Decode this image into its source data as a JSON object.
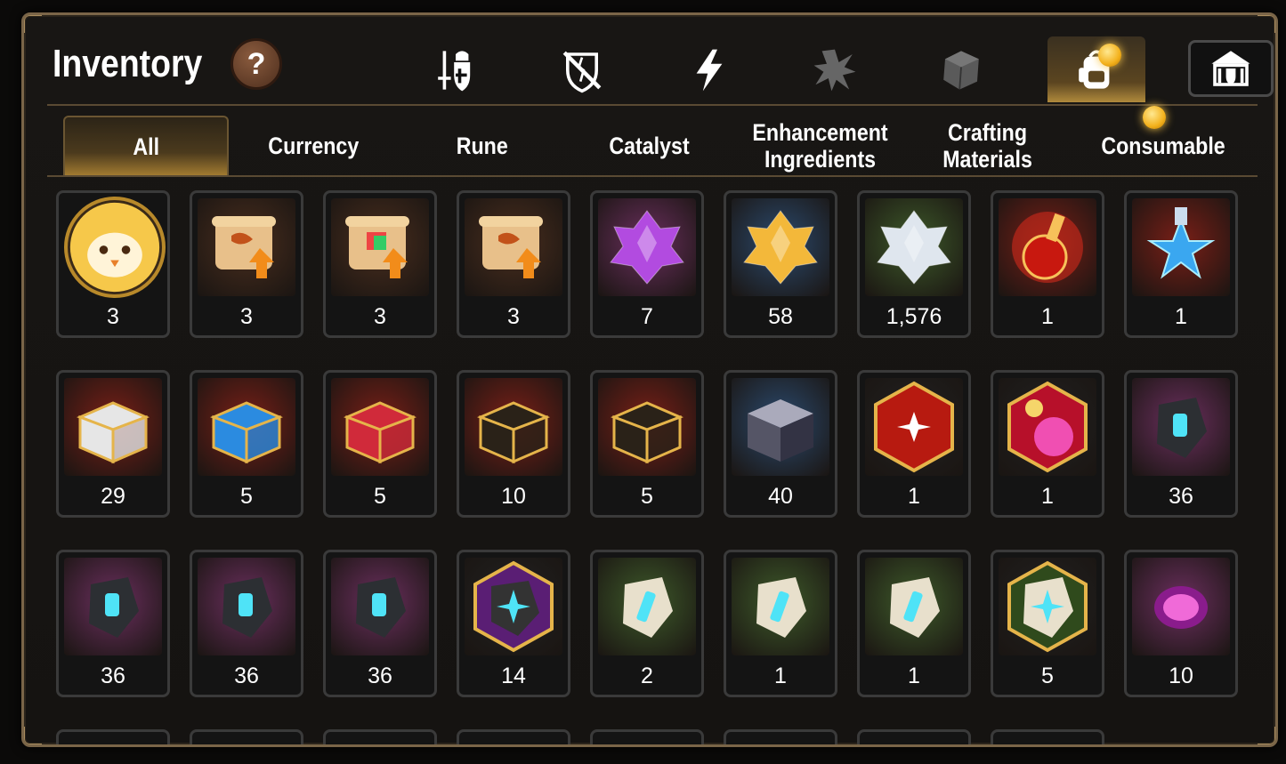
{
  "header": {
    "title": "Inventory",
    "help_label": "?"
  },
  "category_tabs": [
    {
      "icon": "sword-shield-icon",
      "active": false
    },
    {
      "icon": "broken-shield-icon",
      "active": false
    },
    {
      "icon": "lightning-icon",
      "active": false
    },
    {
      "icon": "burst-icon",
      "active": false
    },
    {
      "icon": "cube-icon",
      "active": false
    },
    {
      "icon": "backpack-icon",
      "active": true
    },
    {
      "icon": "guild-icon",
      "active": false
    }
  ],
  "subtabs": [
    {
      "label": "All",
      "active": true
    },
    {
      "label": "Currency",
      "active": false
    },
    {
      "label": "Rune",
      "active": false
    },
    {
      "label": "Catalyst",
      "active": false
    },
    {
      "label": "Enhancement\nIngredients",
      "active": false
    },
    {
      "label": "Crafting\nMaterials",
      "active": false
    },
    {
      "label": "Consumable",
      "active": false
    }
  ],
  "items": [
    {
      "name": "chick-avatar-icon",
      "count": "3"
    },
    {
      "name": "scroll-upgrade-icon",
      "count": "3"
    },
    {
      "name": "rainbow-scroll-upgrade-icon",
      "count": "3"
    },
    {
      "name": "scroll-upgrade-icon",
      "count": "3"
    },
    {
      "name": "purple-crystal-icon",
      "count": "7"
    },
    {
      "name": "gold-crystal-icon",
      "count": "58"
    },
    {
      "name": "silver-crystal-icon",
      "count": "1,576"
    },
    {
      "name": "red-potion-icon",
      "count": "1"
    },
    {
      "name": "blue-star-potion-icon",
      "count": "1"
    },
    {
      "name": "white-chest-icon",
      "count": "29"
    },
    {
      "name": "blue-chest-icon",
      "count": "5"
    },
    {
      "name": "red-chest-icon",
      "count": "5"
    },
    {
      "name": "dark-gold-chest-icon",
      "count": "10"
    },
    {
      "name": "dark-gold-chest-icon",
      "count": "5"
    },
    {
      "name": "silver-cube-icon",
      "count": "40"
    },
    {
      "name": "red-star-gem-icon",
      "count": "1"
    },
    {
      "name": "pink-potion-icon",
      "count": "1"
    },
    {
      "name": "sword-rune-icon",
      "count": "36"
    },
    {
      "name": "helm-rune-icon",
      "count": "36"
    },
    {
      "name": "armor-rune-icon",
      "count": "36"
    },
    {
      "name": "boot-rune-icon",
      "count": "36"
    },
    {
      "name": "star-rune-icon",
      "count": "14"
    },
    {
      "name": "sword-stone-rune-icon",
      "count": "2"
    },
    {
      "name": "armor-stone-rune-icon",
      "count": "1"
    },
    {
      "name": "boot-stone-rune-icon",
      "count": "1"
    },
    {
      "name": "star-stone-rune-icon",
      "count": "5"
    },
    {
      "name": "pink-ring-icon",
      "count": "10"
    }
  ],
  "colors": {
    "gold_accent": "#d9a93a",
    "purple_frame": "#6b2f5e",
    "blue_frame": "#2b4a6e",
    "green_frame": "#3e5a2a",
    "red_frame": "#7a1f17",
    "brown_frame": "#4a2e1e"
  }
}
